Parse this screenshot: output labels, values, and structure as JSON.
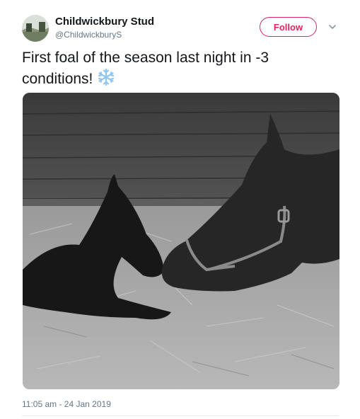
{
  "author": {
    "name": "Childwickbury Stud",
    "handle": "@ChildwickburyS"
  },
  "follow_button": {
    "label": "Follow",
    "color": "#e0245e"
  },
  "menu_icon": "chevron-down-icon",
  "tweet": {
    "text": "First foal of the season last night in -3 conditions!",
    "emoji_icon": "snowflake-icon"
  },
  "timestamp": "11:05 am - 24 Jan 2019"
}
